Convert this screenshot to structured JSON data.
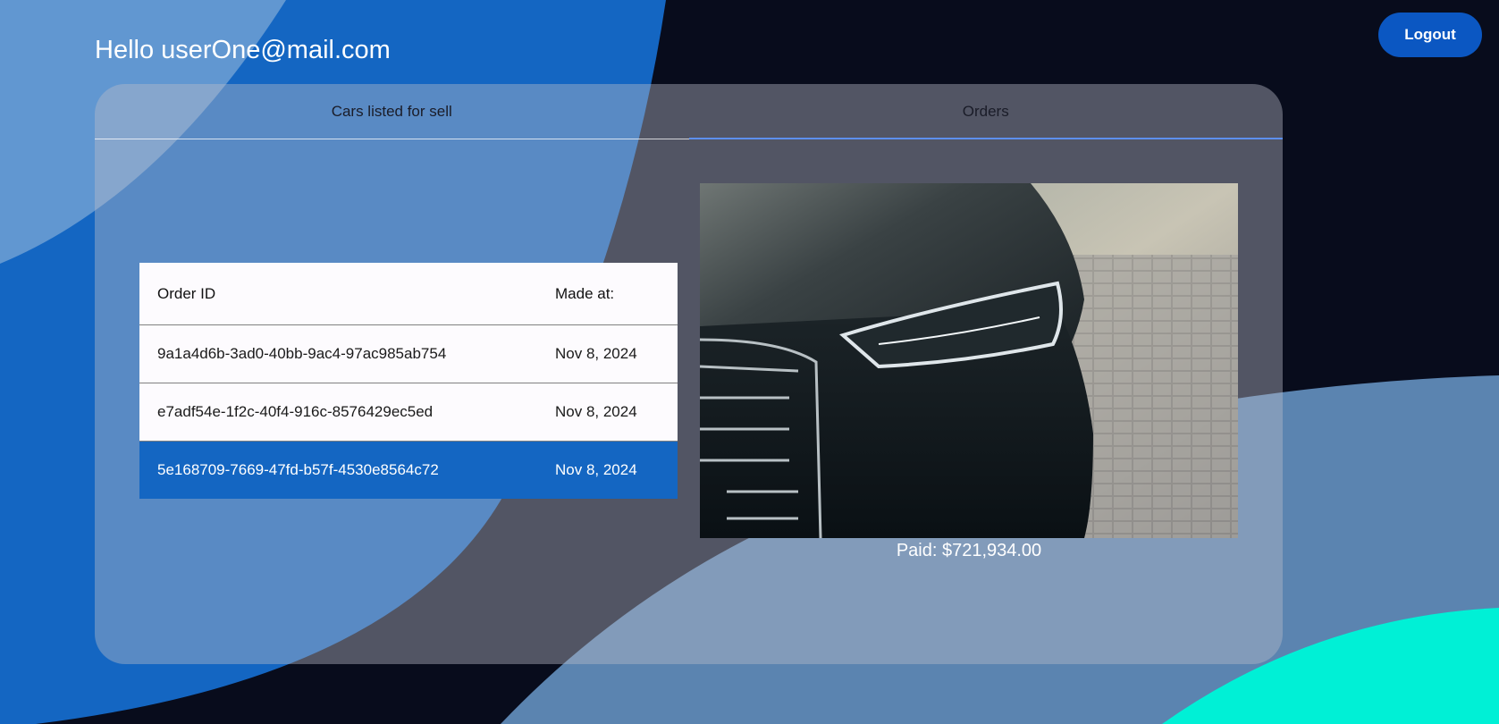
{
  "header": {
    "greeting": "Hello userOne@mail.com",
    "logout_label": "Logout"
  },
  "tabs": [
    {
      "label": "Cars listed for sell",
      "active": false
    },
    {
      "label": "Orders",
      "active": true
    }
  ],
  "orders": {
    "columns": [
      "Order ID",
      "Made at:"
    ],
    "rows": [
      {
        "id": "9a1a4d6b-3ad0-40bb-9ac4-97ac985ab754",
        "made_at": "Nov 8, 2024",
        "selected": false
      },
      {
        "id": "e7adf54e-1f2c-40f4-916c-8576429ec5ed",
        "made_at": "Nov 8, 2024",
        "selected": false
      },
      {
        "id": "5e168709-7669-47fd-b57f-4530e8564c72",
        "made_at": "Nov 8, 2024",
        "selected": true
      }
    ]
  },
  "detail": {
    "paid_text": "Paid: $721,934.00"
  },
  "colors": {
    "background": "#080c1c",
    "blue_shape": "#1466c2",
    "teal_shape": "#00f0d6",
    "logout_button": "#0b57c2",
    "selected_row": "#1466c2"
  }
}
